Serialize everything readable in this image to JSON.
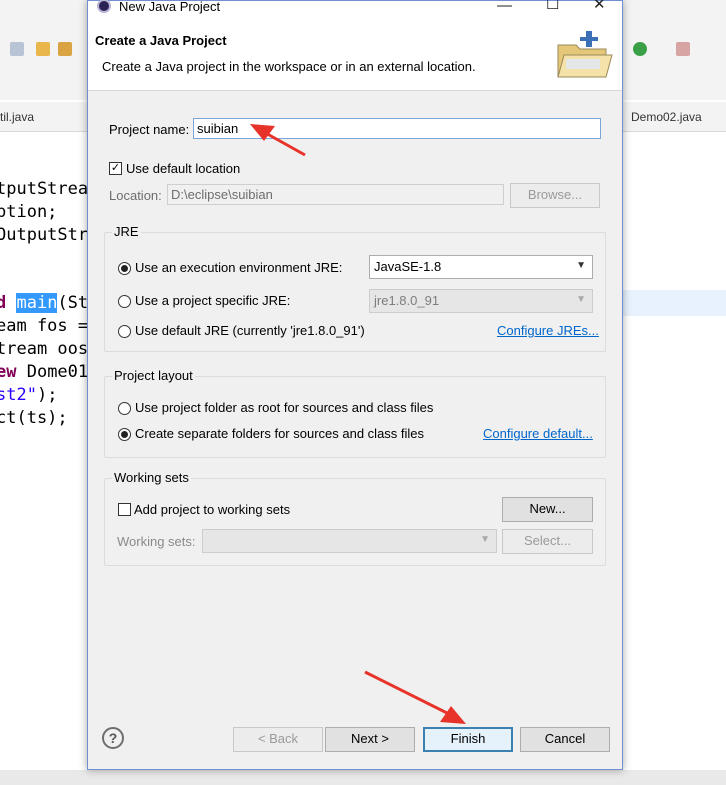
{
  "background_editor": {
    "tabs": [
      "til.java",
      "Demo02.java"
    ],
    "code_lines": [
      {
        "text": "tputStrea"
      },
      {
        "text": "ption;"
      },
      {
        "text": "OutputStr"
      },
      {
        "text": ""
      },
      {
        "text_kw": "d ",
        "text_sel": "main",
        "text": "(St"
      },
      {
        "text": "eam fos ="
      },
      {
        "text": "tream oos"
      },
      {
        "text_kw": "ew ",
        "text": "Dome01"
      },
      {
        "text_str": "st2\"",
        "text": ");"
      },
      {
        "text": "ct(ts);"
      }
    ]
  },
  "dialog": {
    "window_title": "New Java Project",
    "header": {
      "title": "Create a Java Project",
      "subtitle": "Create a Java project in the workspace or in an external location."
    },
    "project_name": {
      "label": "Project name:",
      "value": "suibian"
    },
    "use_default_location": {
      "label": "Use default location",
      "checked": true
    },
    "location": {
      "label": "Location:",
      "value": "D:\\eclipse\\suibian",
      "browse_label": "Browse..."
    },
    "jre": {
      "group_title": "JRE",
      "option_env_label": "Use an execution environment JRE:",
      "option_env_value": "JavaSE-1.8",
      "option_specific_label": "Use a project specific JRE:",
      "option_specific_value": "jre1.8.0_91",
      "option_default_label": "Use default JRE (currently 'jre1.8.0_91')",
      "configure_link": "Configure JREs..."
    },
    "project_layout": {
      "group_title": "Project layout",
      "option_root_label": "Use project folder as root for sources and class files",
      "option_separate_label": "Create separate folders for sources and class files",
      "configure_link": "Configure default..."
    },
    "working_sets": {
      "group_title": "Working sets",
      "add_label": "Add project to working sets",
      "new_label": "New...",
      "sets_label": "Working sets:",
      "select_label": "Select..."
    },
    "footer": {
      "help_icon": "?",
      "back_label": "< Back",
      "next_label": "Next >",
      "finish_label": "Finish",
      "cancel_label": "Cancel"
    }
  },
  "colors": {
    "annotation_arrow": "#e8332a",
    "link": "#0066cc",
    "dialog_border": "#6f8fd4"
  },
  "icons": [
    "eclipse-icon",
    "folder-project-icon",
    "help-icon",
    "minimize-icon",
    "maximize-icon",
    "close-icon",
    "chevron-down-icon"
  ]
}
